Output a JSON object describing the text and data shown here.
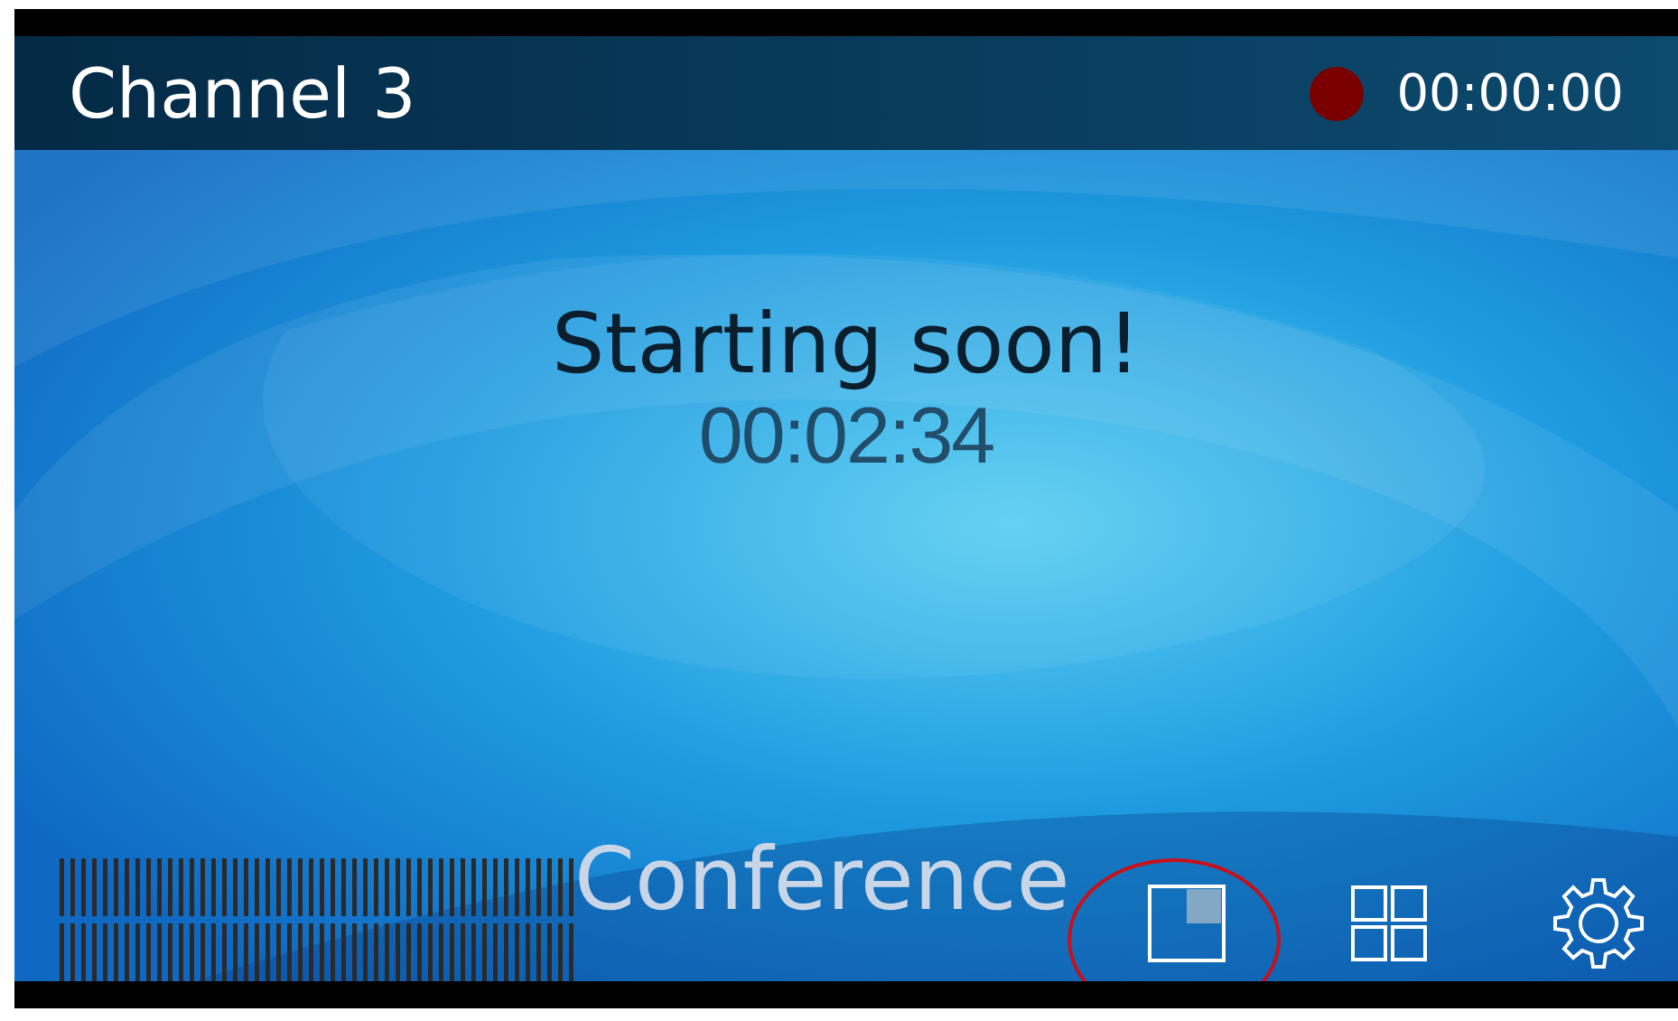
{
  "header": {
    "channel": "Channel 3",
    "recording": true,
    "timer": "00:00:00"
  },
  "content": {
    "title": "Starting soon!",
    "countdown": "00:02:34"
  },
  "footer": {
    "mode_label": "Conference",
    "layouts": [
      {
        "kind": "single",
        "selected": true
      },
      {
        "kind": "grid",
        "selected": false
      }
    ]
  }
}
